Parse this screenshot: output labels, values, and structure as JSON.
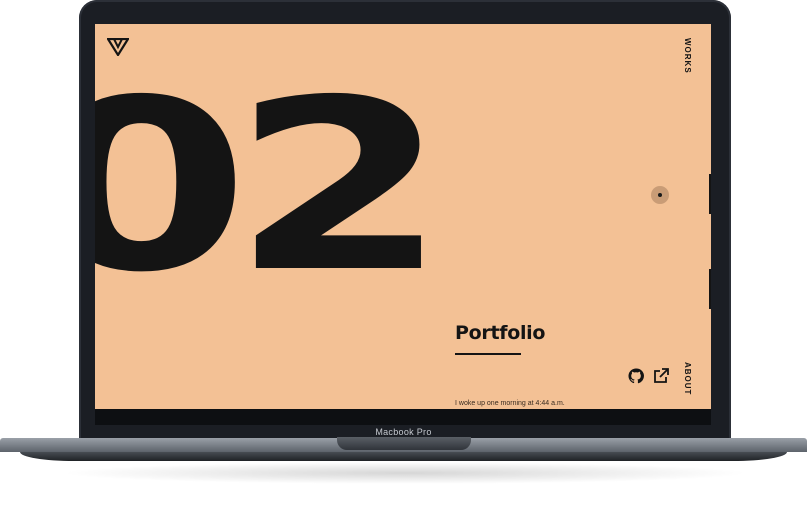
{
  "device": {
    "model_label": "Macbook Pro"
  },
  "hero": {
    "number": "02"
  },
  "nav": {
    "works_label": "WORKS",
    "about_label": "ABOUT"
  },
  "project": {
    "title": "Portfolio",
    "description": "I woke up one morning at 4:44 a.m."
  },
  "icons": [
    "logo-icon",
    "github-icon",
    "external-link-icon"
  ],
  "colors": {
    "background": "#f3c195",
    "text": "#141414",
    "device": "#1b1e24"
  }
}
